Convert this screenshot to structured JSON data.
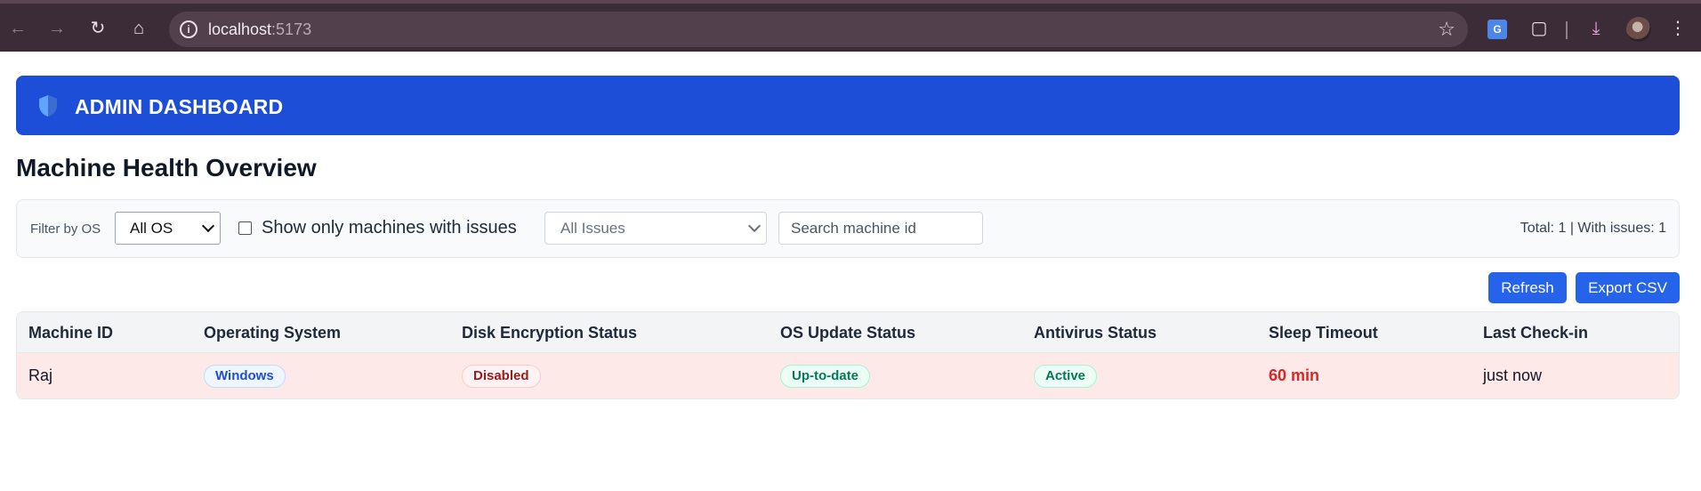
{
  "browser": {
    "url_host": "localhost",
    "url_port": ":5173"
  },
  "header": {
    "title": "ADMIN DASHBOARD"
  },
  "page_title": "Machine Health Overview",
  "filters": {
    "os_label": "Filter by OS",
    "os_selected": "All OS",
    "issues_only_label": "Show only machines with issues",
    "issues_only_checked": false,
    "issue_selected": "All Issues",
    "search_placeholder": "Search machine id",
    "totals_text": "Total: 1 | With issues: 1"
  },
  "actions": {
    "refresh_label": "Refresh",
    "export_label": "Export CSV"
  },
  "table": {
    "columns": [
      "Machine ID",
      "Operating System",
      "Disk Encryption Status",
      "OS Update Status",
      "Antivirus Status",
      "Sleep Timeout",
      "Last Check-in"
    ],
    "rows": [
      {
        "machine_id": "Raj",
        "os": "Windows",
        "disk_encryption": "Disabled",
        "os_update": "Up-to-date",
        "antivirus": "Active",
        "sleep_timeout": "60 min",
        "last_checkin": "just now",
        "has_issue": true
      }
    ]
  },
  "colors": {
    "header_bg": "#1d4ed8",
    "button_bg": "#2563eb",
    "issue_row_bg": "#fee9e9",
    "danger_text": "#dc2626"
  }
}
